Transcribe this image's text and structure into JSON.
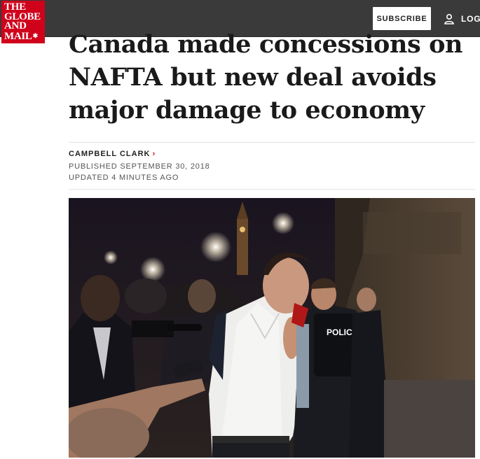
{
  "header": {
    "logo_lines": [
      "THE",
      "GLOBE",
      "AND",
      "MAIL"
    ],
    "subscribe_label": "SUBSCRIBE",
    "login_label": "LOG"
  },
  "article": {
    "headline_lines": [
      "Canada made concessions on",
      "NAFTA but new deal avoids",
      "major damage to economy"
    ],
    "author": "CAMPBELL CLARK",
    "published": "PUBLISHED SEPTEMBER 30, 2018",
    "updated": "UPDATED 4 MINUTES AGO"
  },
  "photo": {
    "vest_text": "POLICE"
  },
  "colors": {
    "brand_red": "#d0021b",
    "header_bg": "#3a3a3a"
  },
  "icons": {
    "user": "person-outline-icon",
    "chevron": "chevron-right-icon",
    "leaf": "maple-leaf-icon"
  }
}
